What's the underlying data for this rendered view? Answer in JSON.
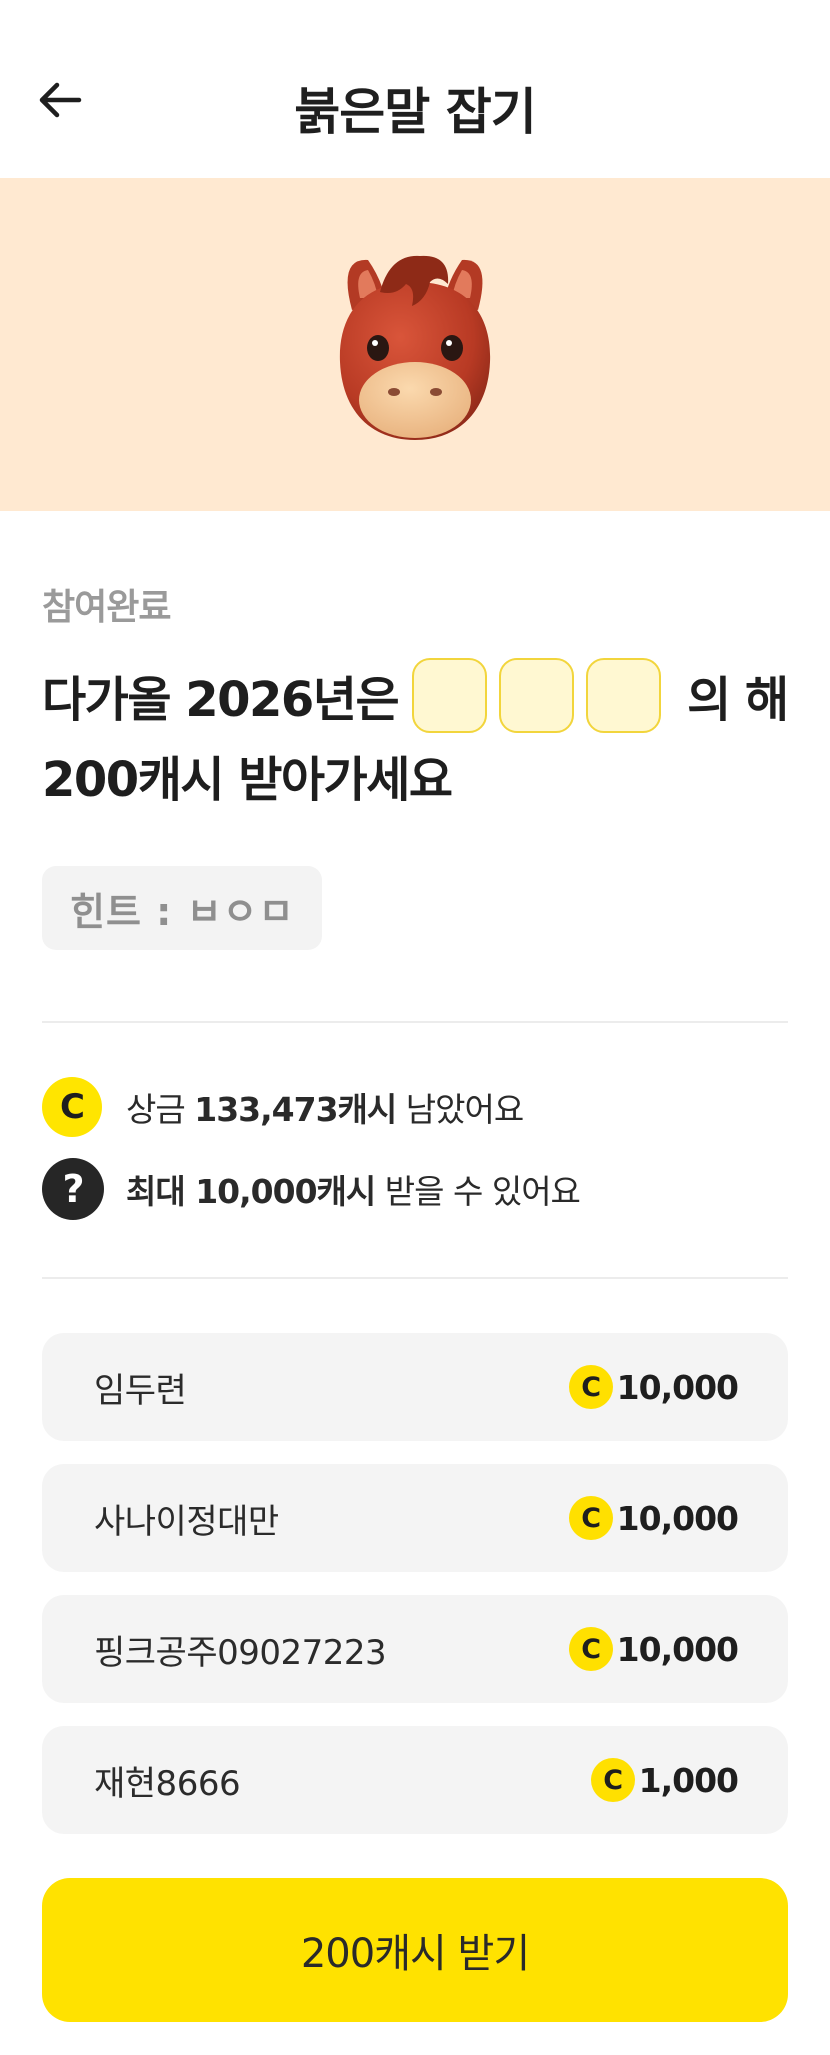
{
  "header": {
    "title": "붉은말 잡기",
    "back_icon": "arrow-left-icon"
  },
  "banner": {
    "image": "red-horse-mascot",
    "background_color": "#ffe9d1"
  },
  "status_label": "참여완료",
  "question": {
    "prefix": "다가올 2026년은",
    "suffix": "의 해",
    "reward_line": "200캐시 받아가세요",
    "blank_count": 3
  },
  "hint": {
    "text": "힌트 : ㅂㅇㅁ"
  },
  "info": {
    "prize": {
      "icon": "coin-icon",
      "coin_symbol": "C",
      "prefix": "상금",
      "amount": "133,473캐시",
      "suffix": "남았어요"
    },
    "max": {
      "icon": "question-icon",
      "symbol": "?",
      "amount": "최대 10,000캐시",
      "suffix": "받을 수 있어요"
    }
  },
  "winners": [
    {
      "name": "임두련",
      "amount": "10,000"
    },
    {
      "name": "사나이정대만",
      "amount": "10,000"
    },
    {
      "name": "핑크공주09027223",
      "amount": "10,000"
    },
    {
      "name": "재현8666",
      "amount": "1,000"
    }
  ],
  "coin_symbol": "C",
  "cta": {
    "label": "200캐시 받기",
    "color": "#ffe200"
  },
  "colors": {
    "accent_yellow": "#ffe500",
    "blank_border": "#f2d53c",
    "blank_fill": "#fff8d2"
  }
}
